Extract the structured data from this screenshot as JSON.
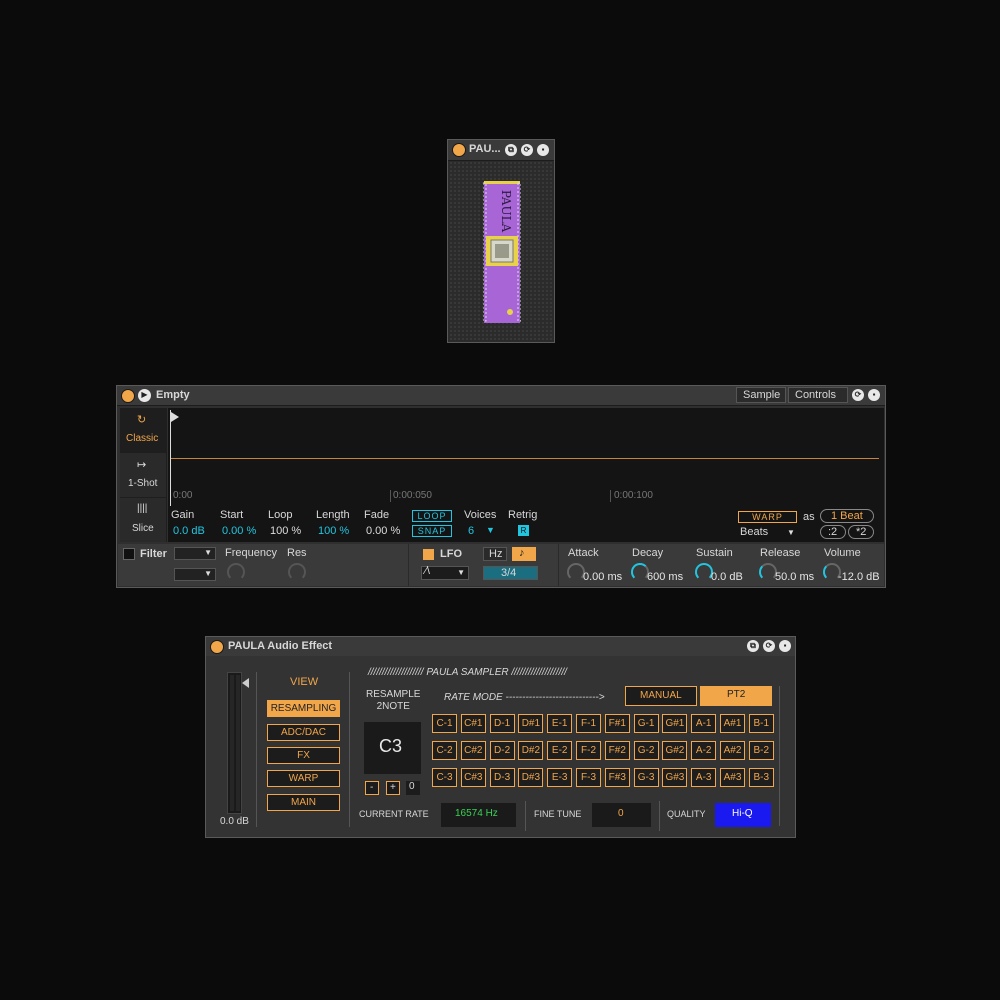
{
  "device_small": {
    "title": "PAU..."
  },
  "simpler": {
    "title": "Empty",
    "tabs": [
      "Sample",
      "Controls"
    ],
    "modes": [
      "Classic",
      "1-Shot",
      "Slice"
    ],
    "timeline": [
      "0:00",
      "0:00:050",
      "0:00:100"
    ],
    "params": [
      {
        "label": "Gain",
        "value": "0.0 dB"
      },
      {
        "label": "Start",
        "value": "0.00 %"
      },
      {
        "label": "Loop",
        "value": "100 %"
      },
      {
        "label": "Length",
        "value": "100 %"
      },
      {
        "label": "Fade",
        "value": "0.00 %"
      }
    ],
    "loop_label": "LOOP",
    "snap_label": "SNAP",
    "voices_label": "Voices",
    "voices_value": "6",
    "retrig_label": "Retrig",
    "retrig_value": "R",
    "warp_label": "WARP",
    "as_label": "as",
    "beat_value": "1 Beat",
    "beats_select": "Beats",
    "half_label": ":2",
    "double_label": "*2",
    "filter_label": "Filter",
    "frequency_label": "Frequency",
    "res_label": "Res",
    "lfo_label": "LFO",
    "hz_label": "Hz",
    "note_icon": "♪",
    "lfo_rate": "3/4",
    "envelope": [
      {
        "label": "Attack",
        "value": "0.00 ms"
      },
      {
        "label": "Decay",
        "value": "600 ms"
      },
      {
        "label": "Sustain",
        "value": "0.0 dB"
      },
      {
        "label": "Release",
        "value": "50.0 ms"
      },
      {
        "label": "Volume",
        "value": "-12.0 dB"
      }
    ]
  },
  "paula": {
    "title": "PAULA Audio Effect",
    "meter_value": "0.0 dB",
    "view_label": "VIEW",
    "view_buttons": [
      "RESAMPLING",
      "ADC/DAC",
      "FX",
      "WARP",
      "MAIN"
    ],
    "header": "//////////////////// PAULA SAMPLER ////////////////////",
    "resample_label": "RESAMPLE\n2NOTE",
    "resample_note": "C3",
    "stepper_minus": "-",
    "stepper_plus": "+",
    "stepper_value": "0",
    "rate_mode_label": "RATE MODE  ---------------------------->",
    "rate_modes": [
      "MANUAL",
      "PT2"
    ],
    "notes": [
      [
        "C-1",
        "C#1",
        "D-1",
        "D#1",
        "E-1",
        "F-1",
        "F#1",
        "G-1",
        "G#1",
        "A-1",
        "A#1",
        "B-1"
      ],
      [
        "C-2",
        "C#2",
        "D-2",
        "D#2",
        "E-2",
        "F-2",
        "F#2",
        "G-2",
        "G#2",
        "A-2",
        "A#2",
        "B-2"
      ],
      [
        "C-3",
        "C#3",
        "D-3",
        "D#3",
        "E-3",
        "F-3",
        "F#3",
        "G-3",
        "G#3",
        "A-3",
        "A#3",
        "B-3"
      ]
    ],
    "current_rate_label": "CURRENT RATE",
    "current_rate_value": "16574 Hz",
    "fine_tune_label": "FINE TUNE",
    "fine_tune_value": "0",
    "quality_label": "QUALITY",
    "quality_value": "Hi-Q"
  },
  "colors": {
    "accent": "#f2a64a",
    "cyan": "#22c5e0",
    "green": "#39d353",
    "quality_blue": "#1a1af0",
    "chip_purple": "#a865d6"
  }
}
